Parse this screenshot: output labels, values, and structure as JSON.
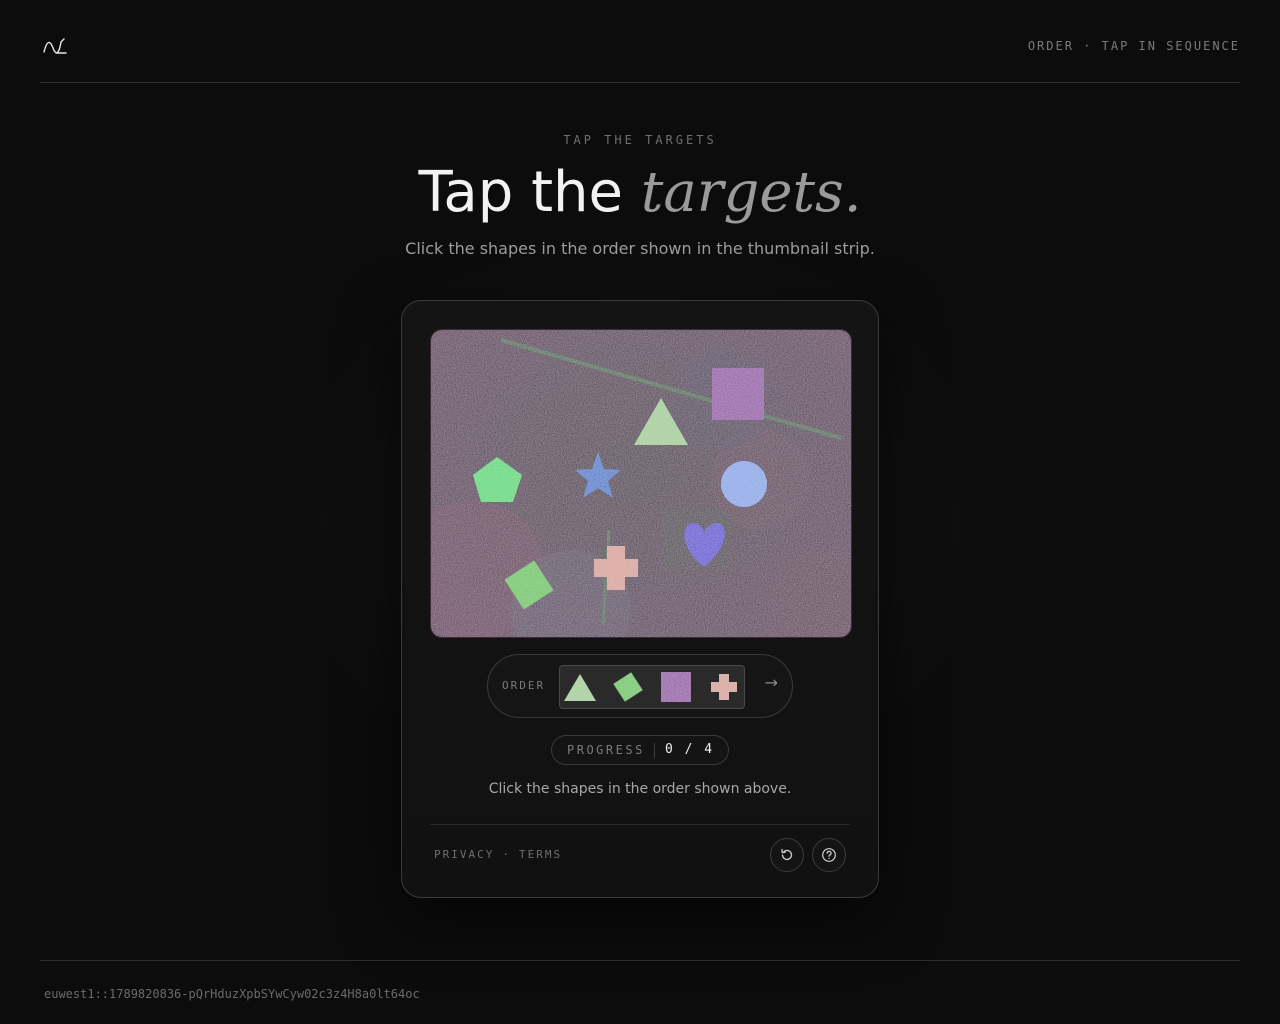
{
  "header": {
    "logo_icon": "wave-logo-icon",
    "right_text": "ORDER · TAP IN SEQUENCE"
  },
  "hero": {
    "eyebrow": "TAP THE TARGETS",
    "title_plain": "Tap the",
    "title_italic": "targets.",
    "subtitle": "Click the shapes in the order shown in the thumbnail strip."
  },
  "challenge": {
    "canvas_shapes": [
      {
        "shape": "triangle",
        "color": "#9cc98f"
      },
      {
        "shape": "square",
        "color": "#8c3aa0"
      },
      {
        "shape": "pentagon",
        "color": "#3ed66a"
      },
      {
        "shape": "star",
        "color": "#2a6fc8"
      },
      {
        "shape": "circle",
        "color": "#7fa0e6"
      },
      {
        "shape": "heart",
        "color": "#4a2ed0"
      },
      {
        "shape": "cross",
        "color": "#d49a90"
      },
      {
        "shape": "diamond",
        "color": "#5cc24c"
      }
    ],
    "order_label": "ORDER",
    "order_sequence": [
      {
        "shape": "triangle",
        "color": "#9cc98f"
      },
      {
        "shape": "diamond",
        "color": "#5cc24c"
      },
      {
        "shape": "square",
        "color": "#8c3aa0"
      },
      {
        "shape": "cross",
        "color": "#d49a90"
      }
    ],
    "arrow": "→",
    "progress_label": "PROGRESS",
    "progress_value": "0 / 4",
    "progress_done": 0,
    "progress_total": 4,
    "instruction": "Click the shapes in the order shown above.",
    "footer_links": {
      "privacy": "PRIVACY",
      "separator": "·",
      "terms": "TERMS"
    },
    "buttons": {
      "refresh_icon": "refresh-icon",
      "help_icon": "help-icon"
    }
  },
  "footer": {
    "session_id": "euwest1::1789820836-pQrHduzXpbSYwCyw02c3z4H8a0lt64oc"
  }
}
